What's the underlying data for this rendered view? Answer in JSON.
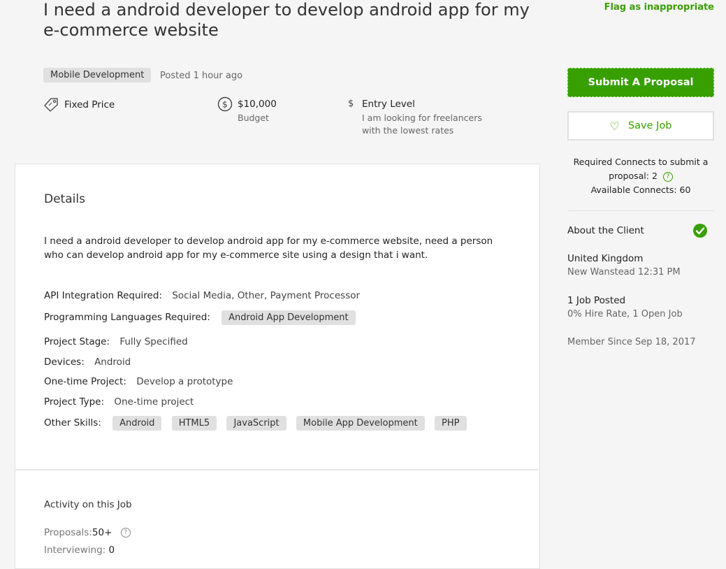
{
  "job": {
    "title": "I need a android developer to develop android app for my e-commerce website",
    "flag_label": "Flag as inappropriate",
    "category": "Mobile Development",
    "posted": "Posted 1 hour ago"
  },
  "meta": {
    "price_type": "Fixed Price",
    "budget_value": "$10,000",
    "budget_label": "Budget",
    "level_title": "Entry Level",
    "level_desc": "I am looking for freelancers with the lowest rates"
  },
  "details": {
    "heading": "Details",
    "description": "I need a android developer to develop android app for my e-commerce website, need a person who can develop android app for my e-commerce site using a design that i want.",
    "api_label": "API Integration Required:",
    "api_value": "Social Media, Other, Payment Processor",
    "prog_label": "Programming Languages Required:",
    "prog_value": "Android App Development",
    "stage_label": "Project Stage:",
    "stage_value": "Fully Specified",
    "devices_label": "Devices:",
    "devices_value": "Android",
    "onetime_label": "One-time Project:",
    "onetime_value": "Develop a prototype",
    "type_label": "Project Type:",
    "type_value": "One-time project",
    "skills_label": "Other Skills:",
    "skills": [
      "Android",
      "HTML5",
      "JavaScript",
      "Mobile App Development",
      "PHP"
    ]
  },
  "activity": {
    "heading": "Activity on this Job",
    "proposals_label": "Proposals:",
    "proposals_value": "50+",
    "interviewing_label": "Interviewing:",
    "interviewing_value": "0"
  },
  "sidebar": {
    "submit_label": "Submit A Proposal",
    "save_label": "Save Job",
    "connects_required": "Required Connects to submit a proposal: 2",
    "connects_available": "Available Connects: 60"
  },
  "client": {
    "heading": "About the Client",
    "country": "United Kingdom",
    "city_time": "New Wanstead 12:31 PM",
    "jobs_posted": "1 Job Posted",
    "hire_rate": "0% Hire Rate, 1 Open Job",
    "member_since": "Member Since Sep 18, 2017"
  },
  "colors": {
    "accent": "#37a000",
    "background": "#f5f5f5",
    "tag_bg": "#e0e0e0"
  }
}
